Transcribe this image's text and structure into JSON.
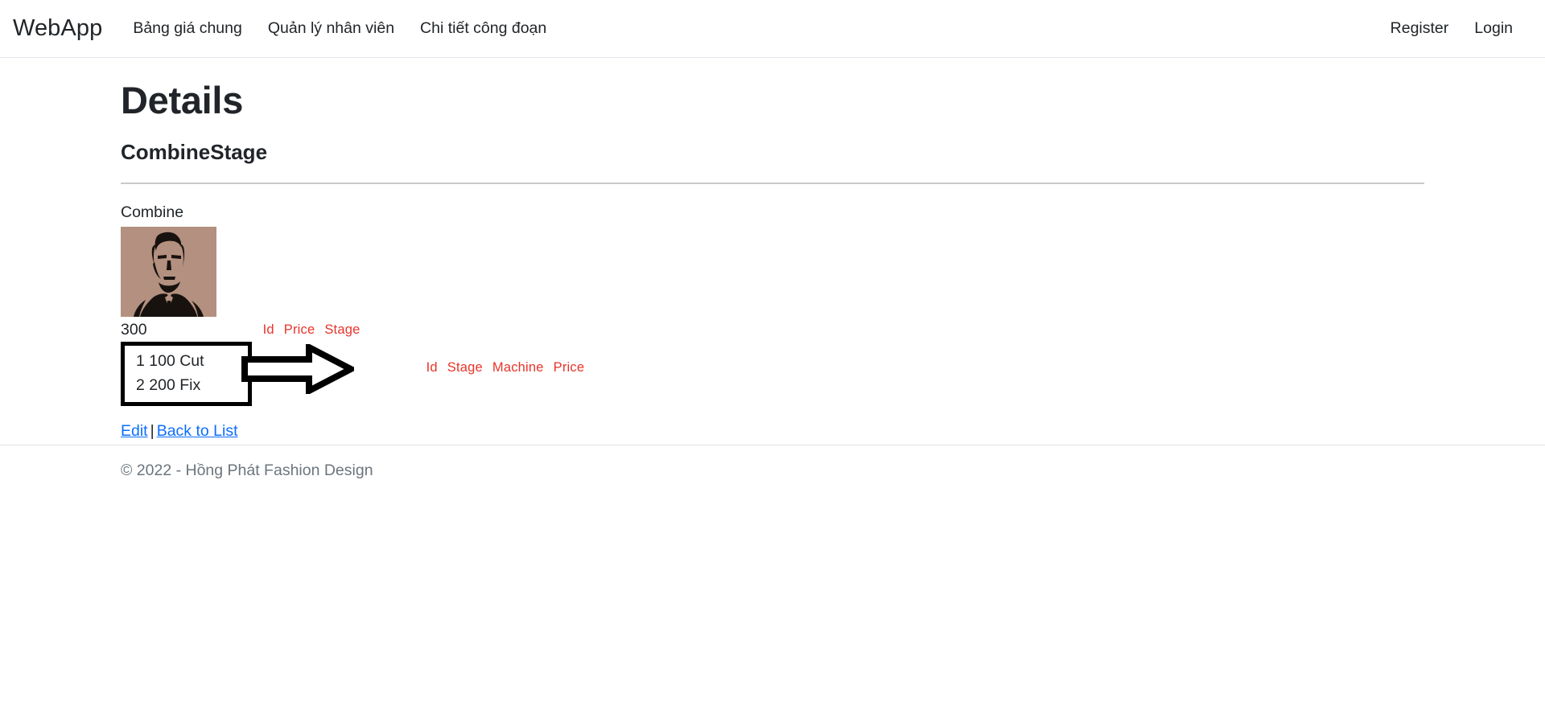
{
  "navbar": {
    "brand": "WebApp",
    "links": [
      {
        "label": "Bảng giá chung"
      },
      {
        "label": "Quản lý nhân viên"
      },
      {
        "label": "Chi tiết công đoạn"
      }
    ],
    "right_links": [
      {
        "label": "Register"
      },
      {
        "label": "Login"
      }
    ]
  },
  "main": {
    "page_title": "Details",
    "section_title": "CombineStage",
    "combine_label": "Combine",
    "image_alt": "portrait-thumbnail",
    "total_value": "300",
    "boxed_table": {
      "rows": [
        "1 100 Cut",
        "2 200 Fix"
      ]
    },
    "red_headers_1": {
      "col1": "Id",
      "col2": "Price",
      "col3": "Stage"
    },
    "red_headers_2": {
      "col1": "Id",
      "col2": "Stage",
      "col3": "Machine",
      "col4": "Price"
    },
    "actions": {
      "edit": "Edit",
      "separator": "|",
      "back_to_list": "Back to List"
    }
  },
  "footer": {
    "copyright": "© 2022 - Hồng Phát Fashion Design"
  },
  "colors": {
    "accent_red": "#e8342a",
    "link_blue": "#0d6efd",
    "thumb_bg": "#b3907f",
    "text": "#212529",
    "muted": "#6c757d"
  },
  "icons": {
    "arrow": "right-block-arrow-icon"
  }
}
